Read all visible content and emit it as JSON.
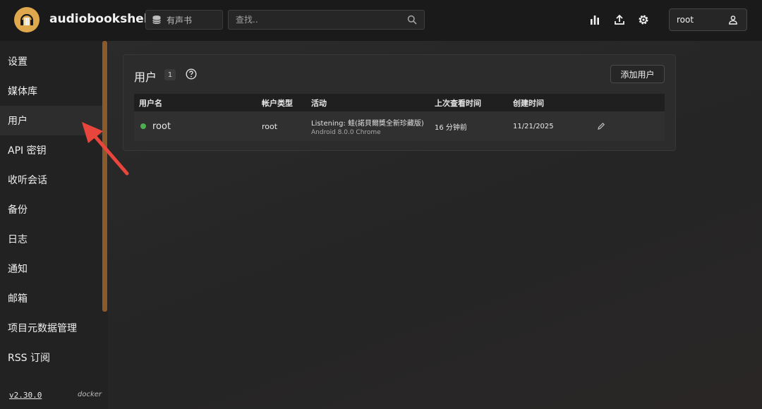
{
  "app": {
    "title": "audiobookshelf"
  },
  "header": {
    "library_label": "有声书",
    "search_placeholder": "查找..",
    "user_name": "root"
  },
  "sidebar": {
    "items": [
      {
        "label": "设置"
      },
      {
        "label": "媒体库"
      },
      {
        "label": "用户"
      },
      {
        "label": "API 密钥"
      },
      {
        "label": "收听会话"
      },
      {
        "label": "备份"
      },
      {
        "label": "日志"
      },
      {
        "label": "通知"
      },
      {
        "label": "邮箱"
      },
      {
        "label": "项目元数据管理"
      },
      {
        "label": "RSS 订阅"
      }
    ],
    "active_index": 2,
    "version": "v2.30.0",
    "platform": "docker"
  },
  "users_panel": {
    "title": "用户",
    "count": "1",
    "add_button_label": "添加用户",
    "columns": [
      "用户名",
      "帐户类型",
      "活动",
      "上次查看时间",
      "创建时间"
    ],
    "rows": [
      {
        "username": "root",
        "account_type": "root",
        "activity_title": "Listening: 蛙(諾貝爾獎全新珍藏版)",
        "activity_device": "Android 8.0.0 Chrome",
        "last_seen": "16 分钟前",
        "created": "11/21/2025",
        "online": true
      }
    ]
  },
  "colors": {
    "accent": "#e0a84c",
    "online": "#4caf50",
    "annotation_arrow": "#e8463c",
    "scrollbar": "#8b5a2b"
  }
}
